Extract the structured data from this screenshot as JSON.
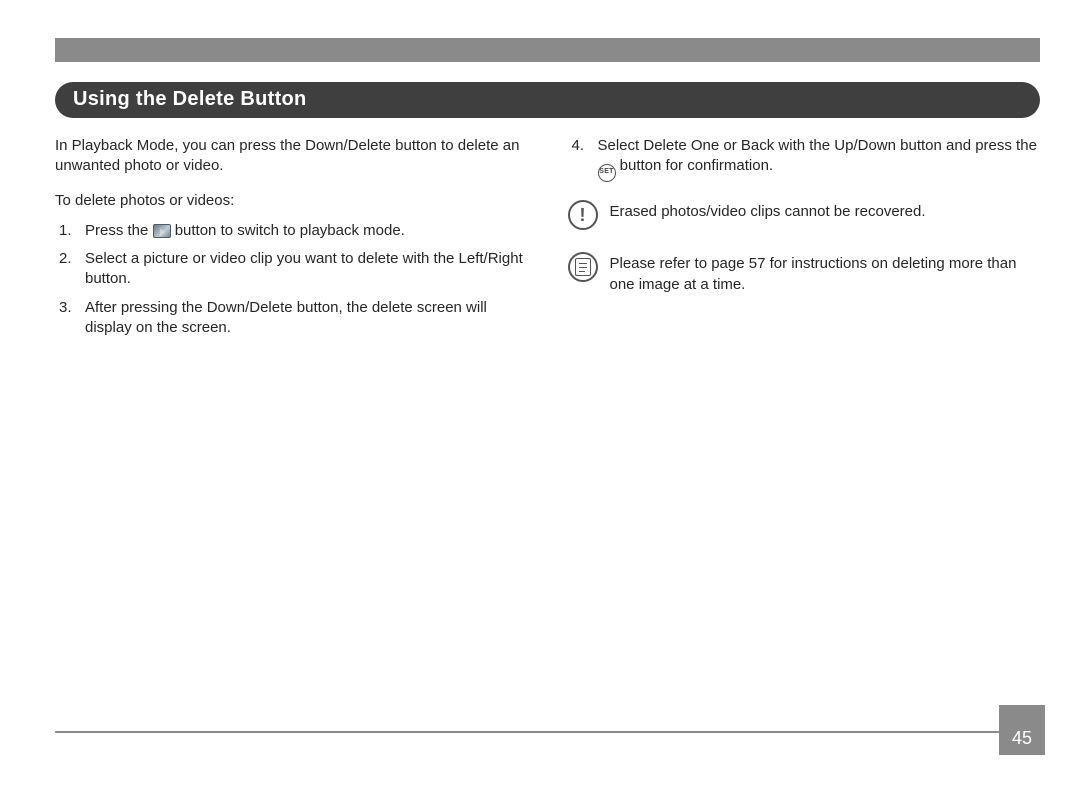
{
  "section_title": "Using the Delete Button",
  "left": {
    "intro": "In Playback Mode, you can press the Down/Delete button to delete an unwanted photo or video.",
    "subhead": "To delete photos or videos:",
    "step1_a": "Press the ",
    "step1_b": " button to switch to playback mode.",
    "step2": "Select a picture or video clip you want to delete with the Left/Right button.",
    "step3": "After pressing the Down/Delete button, the delete screen will display on the screen."
  },
  "right": {
    "step4_a": "Select Delete One or Back with the Up/Down button and press the ",
    "step4_b": " button for confirmation.",
    "set_label": "SET",
    "warning": "Erased photos/video clips cannot be recovered.",
    "note": "Please refer to page 57 for instructions on deleting more than one image at a time."
  },
  "page_number": "45"
}
